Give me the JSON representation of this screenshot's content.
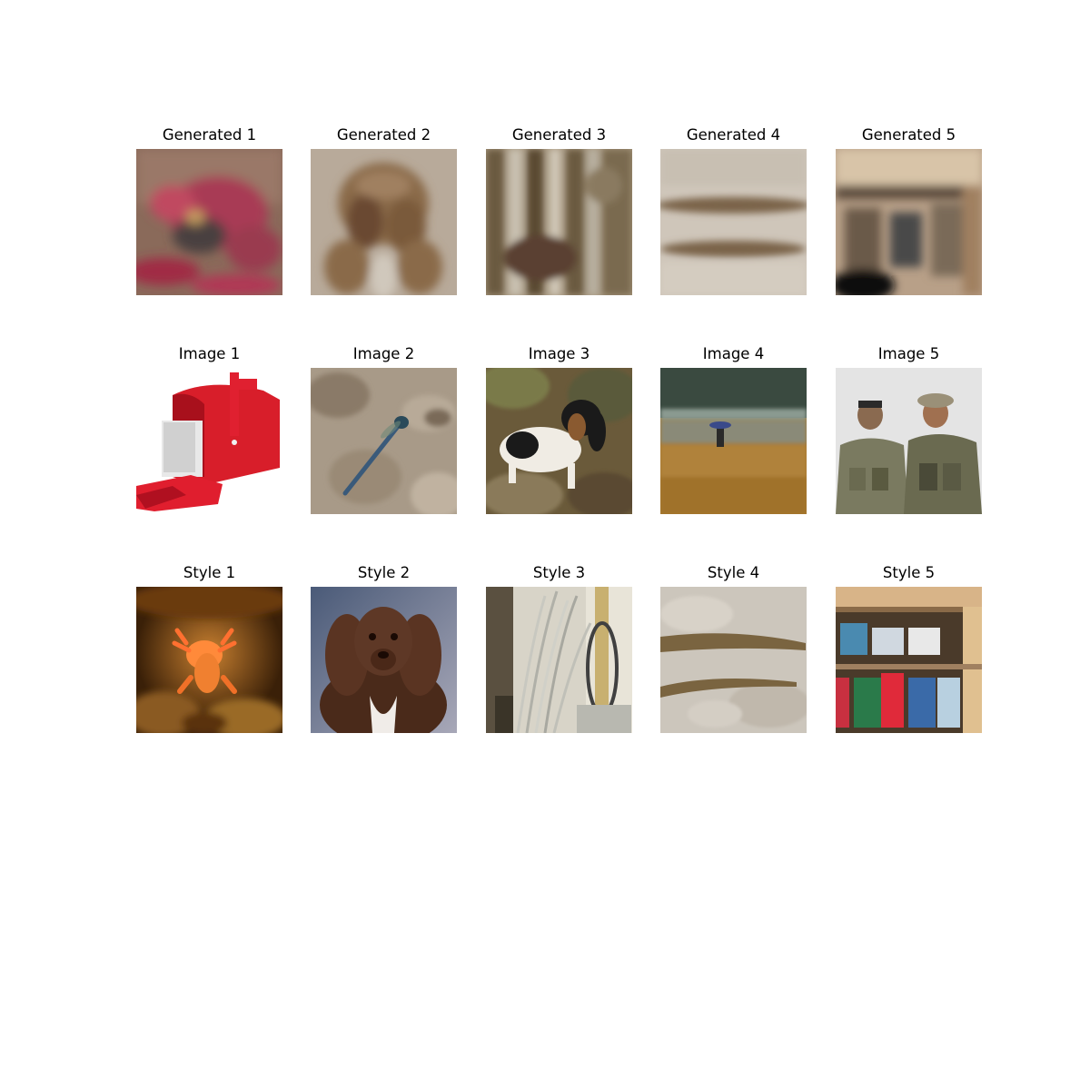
{
  "rows": [
    {
      "name": "generated",
      "cells": [
        {
          "title": "Generated 1",
          "icon": "blurry-red-blob-image"
        },
        {
          "title": "Generated 2",
          "icon": "blurry-brown-dog-image"
        },
        {
          "title": "Generated 3",
          "icon": "blurry-striped-image"
        },
        {
          "title": "Generated 4",
          "icon": "blurry-horizontal-bands-image"
        },
        {
          "title": "Generated 5",
          "icon": "blurry-cabinet-image"
        }
      ]
    },
    {
      "name": "content",
      "cells": [
        {
          "title": "Image 1",
          "icon": "red-mailbox-image"
        },
        {
          "title": "Image 2",
          "icon": "dragonfly-on-sand-image"
        },
        {
          "title": "Image 3",
          "icon": "basset-puppy-image"
        },
        {
          "title": "Image 4",
          "icon": "beach-person-image"
        },
        {
          "title": "Image 5",
          "icon": "two-soldiers-image"
        }
      ]
    },
    {
      "name": "style",
      "cells": [
        {
          "title": "Style 1",
          "icon": "axolotl-image"
        },
        {
          "title": "Style 2",
          "icon": "spaniel-portrait-image"
        },
        {
          "title": "Style 3",
          "icon": "whisks-in-jar-image"
        },
        {
          "title": "Style 4",
          "icon": "eels-on-sand-image"
        },
        {
          "title": "Style 5",
          "icon": "cupboard-bottles-image"
        }
      ]
    }
  ]
}
